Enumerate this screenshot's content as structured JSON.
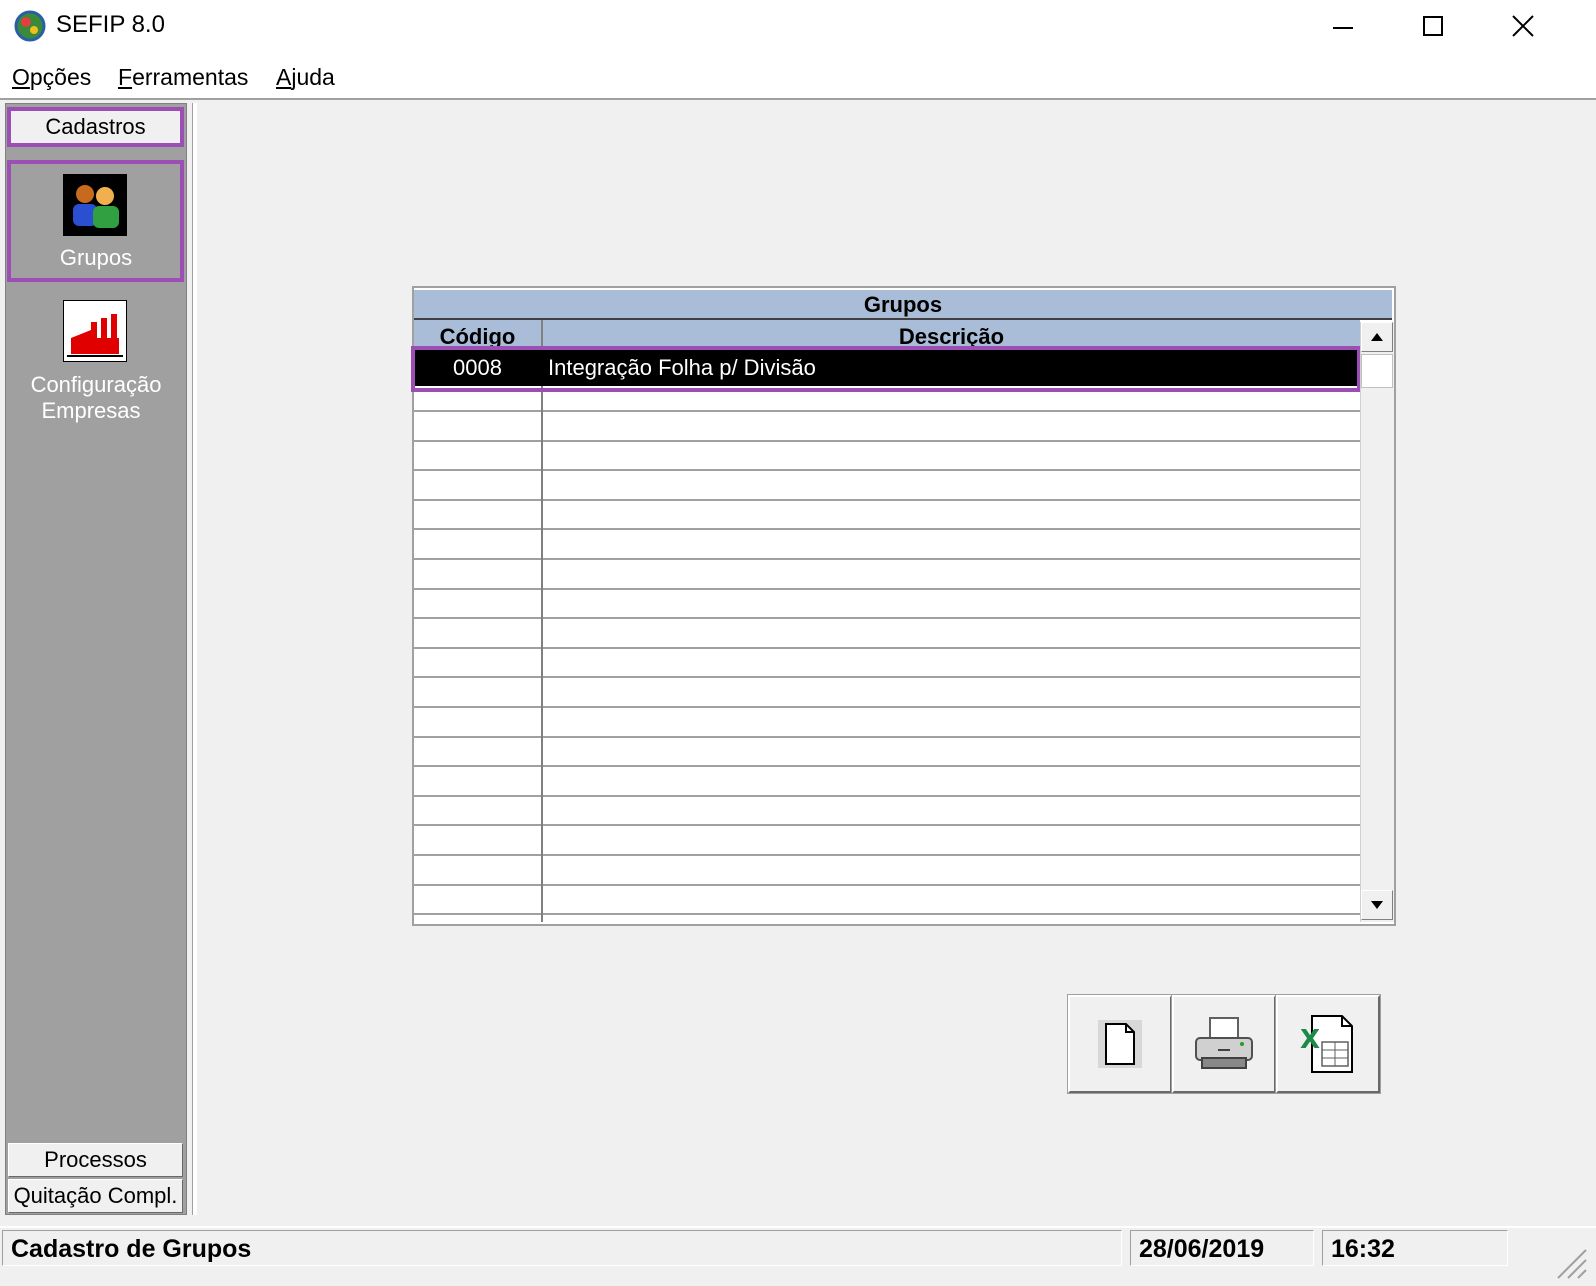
{
  "window": {
    "title": "SEFIP 8.0",
    "minimize_icon": "minimize-icon",
    "maximize_icon": "maximize-icon",
    "close_icon": "close-icon"
  },
  "menu": {
    "items": [
      {
        "first": "O",
        "rest": "pções"
      },
      {
        "first": "F",
        "rest": "erramentas"
      },
      {
        "first": "A",
        "rest": "juda"
      }
    ]
  },
  "sidebar": {
    "header": "Cadastros",
    "tools": [
      {
        "label": "Grupos",
        "icon": "groups-users-icon"
      },
      {
        "label_line1": "Configuração",
        "label_line2": "Empresas",
        "icon": "factory-icon"
      }
    ],
    "bottom_buttons": [
      "Processos",
      "Quitação Compl."
    ]
  },
  "grid": {
    "title": "Grupos",
    "columns": [
      "Código",
      "Descrição"
    ],
    "rows": [
      {
        "codigo": "0008",
        "descricao": "Integração Folha p/ Divisão"
      }
    ]
  },
  "actions": [
    {
      "name": "new-document-button",
      "icon": "blank-document-icon"
    },
    {
      "name": "print-button",
      "icon": "printer-icon"
    },
    {
      "name": "export-excel-button",
      "icon": "excel-icon"
    }
  ],
  "status": {
    "message": "Cadastro de Grupos",
    "date": "28/06/2019",
    "time": "16:32"
  },
  "colors": {
    "highlight": "#9b4fb4",
    "grid_header": "#a9bdd8",
    "sidebar_bg": "#a0a0a0"
  }
}
